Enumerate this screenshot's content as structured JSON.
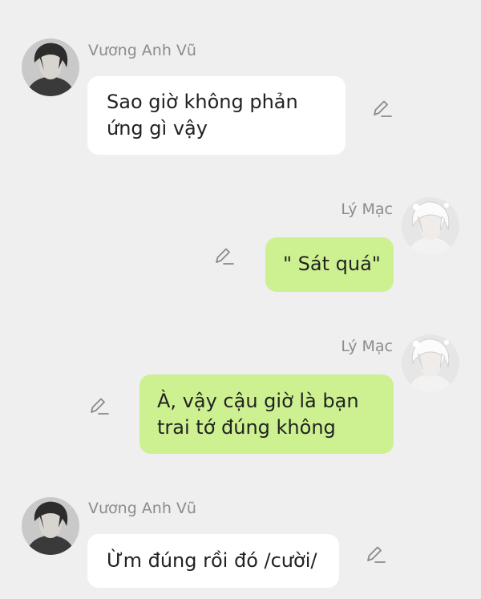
{
  "messages": [
    {
      "sender": "Vương Anh Vũ",
      "side": "left",
      "lines": [
        "Sao giờ không phản",
        "ứng gì vậy"
      ],
      "avatar_icon": "dark-hair-character-avatar",
      "edit_icon": "pencil-edit-icon"
    },
    {
      "sender": "Lý Mạc",
      "side": "right",
      "lines": [
        "\" Sát quá\""
      ],
      "avatar_icon": "white-hair-character-avatar",
      "edit_icon": "pencil-edit-icon"
    },
    {
      "sender": "Lý Mạc",
      "side": "right",
      "lines": [
        "À, vậy cậu giờ là bạn",
        "trai tớ đúng không"
      ],
      "avatar_icon": "white-hair-character-avatar",
      "edit_icon": "pencil-edit-icon"
    },
    {
      "sender": "Vương Anh Vũ",
      "side": "left",
      "lines": [
        "Ừm đúng rồi đó /cười/"
      ],
      "avatar_icon": "dark-hair-character-avatar",
      "edit_icon": "pencil-edit-icon"
    }
  ],
  "colors": {
    "background": "#efefef",
    "incoming_bubble": "#ffffff",
    "outgoing_bubble": "#cdf191",
    "sender_name": "#8c8c8c",
    "message_text": "#222222",
    "edit_icon": "#8a8a8a"
  }
}
